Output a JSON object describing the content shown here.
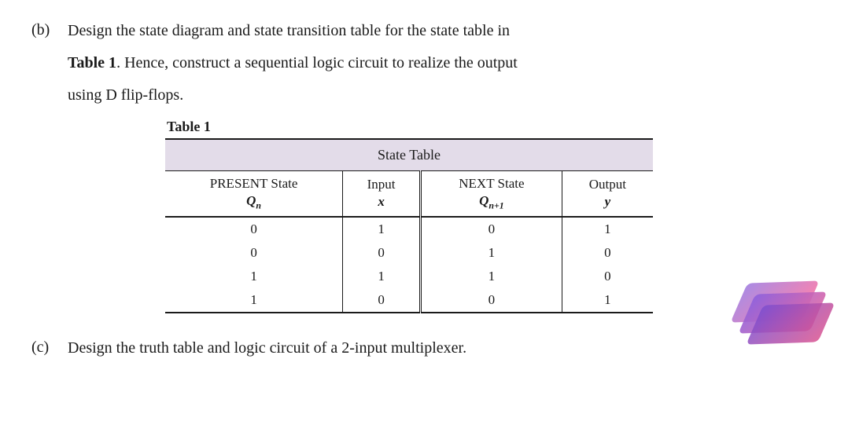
{
  "question_b": {
    "label": "(b)",
    "text_line1": "Design the state diagram and state transition table for the state table in",
    "text_line2_prefix": "Table 1",
    "text_line2_rest": ". Hence, construct a sequential logic circuit to realize the output",
    "text_line3": "using D flip-flops."
  },
  "table": {
    "title": "Table 1",
    "header_top": "State Table",
    "columns": {
      "col1_top": "PRESENT State",
      "col1_sub": "Q",
      "col1_subscript": "n",
      "col2_top": "Input",
      "col2_sub": "x",
      "col3_top": "NEXT State",
      "col3_sub": "Q",
      "col3_subscript": "n+1",
      "col4_top": "Output",
      "col4_sub": "y"
    },
    "rows": [
      {
        "qn": "0",
        "x": "1",
        "qn1": "0",
        "y": "1"
      },
      {
        "qn": "0",
        "x": "0",
        "qn1": "1",
        "y": "0"
      },
      {
        "qn": "1",
        "x": "1",
        "qn1": "1",
        "y": "0"
      },
      {
        "qn": "1",
        "x": "0",
        "qn1": "0",
        "y": "1"
      }
    ]
  },
  "question_c": {
    "label": "(c)",
    "text": "Design the truth table and logic circuit of a 2-input multiplexer."
  },
  "chart_data": {
    "type": "table",
    "title": "State Table",
    "columns": [
      "PRESENT State Qn",
      "Input x",
      "NEXT State Qn+1",
      "Output y"
    ],
    "rows": [
      [
        0,
        1,
        0,
        1
      ],
      [
        0,
        0,
        1,
        0
      ],
      [
        1,
        1,
        1,
        0
      ],
      [
        1,
        0,
        0,
        1
      ]
    ]
  }
}
